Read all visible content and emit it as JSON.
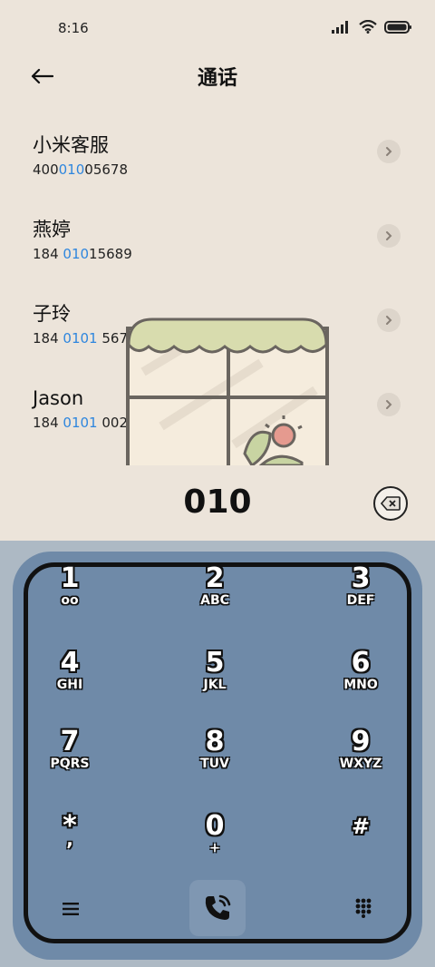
{
  "status": {
    "time": "8:16"
  },
  "header": {
    "title": "通话"
  },
  "contacts": [
    {
      "name": "小米客服",
      "num_pre": "400",
      "num_hl": "010",
      "num_post": "05678"
    },
    {
      "name": "燕婷",
      "num_pre": "184 ",
      "num_hl": "010",
      "num_post": "15689"
    },
    {
      "name": "子玲",
      "num_pre": "184 ",
      "num_hl": "0101",
      "num_post": " 5678"
    },
    {
      "name": "Jason",
      "num_pre": "184 ",
      "num_hl": "0101",
      "num_post": " 0029"
    }
  ],
  "dialer": {
    "number": "010"
  },
  "keys": [
    {
      "digit": "1",
      "letters": "oo"
    },
    {
      "digit": "2",
      "letters": "ABC"
    },
    {
      "digit": "3",
      "letters": "DEF"
    },
    {
      "digit": "4",
      "letters": "GHI"
    },
    {
      "digit": "5",
      "letters": "JKL"
    },
    {
      "digit": "6",
      "letters": "MNO"
    },
    {
      "digit": "7",
      "letters": "PQRS"
    },
    {
      "digit": "8",
      "letters": "TUV"
    },
    {
      "digit": "9",
      "letters": "WXYZ"
    },
    {
      "digit": "*",
      "letters": ","
    },
    {
      "digit": "0",
      "letters": "+"
    },
    {
      "digit": "#",
      "letters": ""
    }
  ],
  "colors": {
    "background": "#ece4da",
    "highlight": "#2e86de",
    "keypad": "#6f8aa8"
  }
}
